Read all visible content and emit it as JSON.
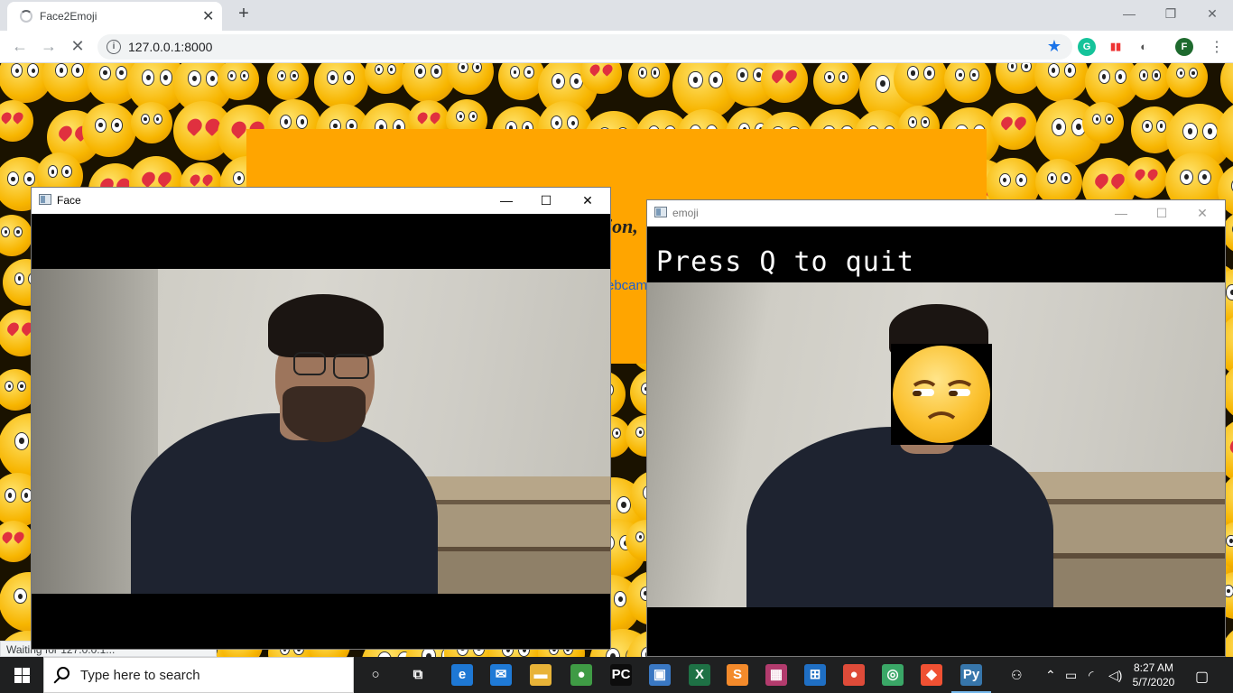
{
  "browser": {
    "tab_title": "Face2Emoji",
    "tab_close": "✕",
    "new_tab": "+",
    "url": "127.0.0.1:8000",
    "profile_initial": "F",
    "window_controls": {
      "minimize": "—",
      "maximize": "❐",
      "close": "✕"
    }
  },
  "page": {
    "heading_fragment": "ion,",
    "link_fragment": "ebcam",
    "status_text": "Waiting for 127.0.0.1..."
  },
  "face_window": {
    "title": "Face",
    "controls": {
      "minimize": "—",
      "maximize": "☐",
      "close": "✕"
    }
  },
  "emoji_window": {
    "title": "emoji",
    "overlay_text": "Press Q to quit",
    "controls": {
      "minimize": "—",
      "maximize": "☐",
      "close": "✕"
    }
  },
  "taskbar": {
    "search_placeholder": "Type here to search",
    "time": "8:27 AM",
    "date": "5/7/2020",
    "apps": [
      {
        "icon": "cortana-icon",
        "label": "○",
        "color": "transparent"
      },
      {
        "icon": "task-view-icon",
        "label": "⧉",
        "color": "transparent"
      },
      {
        "icon": "edge-icon",
        "label": "e",
        "color": "#1e78d4"
      },
      {
        "icon": "mail-icon",
        "label": "✉",
        "color": "#1f7ad6"
      },
      {
        "icon": "file-explorer-icon",
        "label": "▬",
        "color": "#e8b338"
      },
      {
        "icon": "chrome-profile-icon",
        "label": "●",
        "color": "#3f9b45"
      },
      {
        "icon": "pycharm-icon",
        "label": "PC",
        "color": "#0d0d0d"
      },
      {
        "icon": "remote-desktop-icon",
        "label": "▣",
        "color": "#3a78c3"
      },
      {
        "icon": "excel-icon",
        "label": "X",
        "color": "#1e7145"
      },
      {
        "icon": "sublime-icon",
        "label": "S",
        "color": "#f38a2b"
      },
      {
        "icon": "winrar-icon",
        "label": "▦",
        "color": "#b23b6d"
      },
      {
        "icon": "store-icon",
        "label": "⊞",
        "color": "#1f6fc4"
      },
      {
        "icon": "chrome-icon",
        "label": "●",
        "color": "#de4b39"
      },
      {
        "icon": "maps-icon",
        "label": "◎",
        "color": "#3aa767"
      },
      {
        "icon": "git-icon",
        "label": "◆",
        "color": "#f05133"
      },
      {
        "icon": "python-icon",
        "label": "Py",
        "color": "#3776ab"
      }
    ]
  }
}
